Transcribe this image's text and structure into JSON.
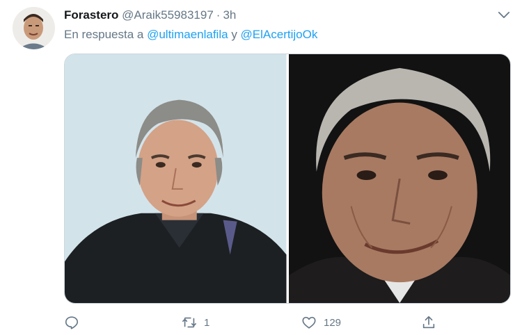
{
  "tweet": {
    "author_name": "Forastero",
    "author_handle": "@Araik55983197",
    "separator": "·",
    "time": "3h",
    "reply_prefix": "En respuesta a",
    "mention_1": "@ultimaenlafila",
    "conjunction": "y",
    "mention_2": "@ElAcertijoOk"
  },
  "media": {
    "photo_left": "portrait-photo",
    "photo_right": "portrait-photo"
  },
  "actions": {
    "reply_icon": "comment-icon",
    "retweet_icon": "retweet-icon",
    "retweet_count": "1",
    "like_icon": "heart-icon",
    "like_count": "129",
    "share_icon": "share-icon"
  },
  "colors": {
    "accent": "#1da1f2",
    "secondary_text": "#657786",
    "primary_text": "#14171a"
  }
}
